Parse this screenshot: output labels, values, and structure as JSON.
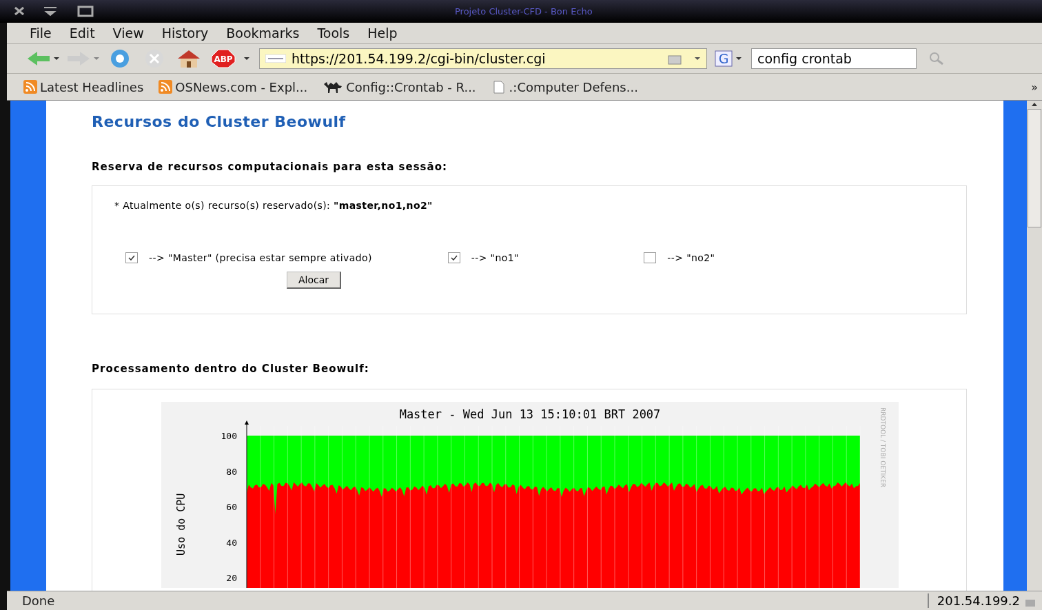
{
  "window": {
    "title": "Projeto Cluster-CFD - Bon Echo"
  },
  "menu": [
    "File",
    "Edit",
    "View",
    "History",
    "Bookmarks",
    "Tools",
    "Help"
  ],
  "toolbar": {
    "abp_label": "ABP",
    "url": "https://201.54.199.2/cgi-bin/cluster.cgi",
    "search_engine": "G",
    "search": "config crontab"
  },
  "bookmarks": {
    "items": [
      {
        "kind": "feed",
        "label": "Latest Headlines"
      },
      {
        "kind": "feed",
        "label": "OSNews.com - Expl..."
      },
      {
        "kind": "camel",
        "label": "Config::Crontab - R..."
      },
      {
        "kind": "page",
        "label": ".:Computer Defens..."
      }
    ],
    "more": "»"
  },
  "page": {
    "title": "Recursos do Cluster Beowulf",
    "reserve": {
      "heading": "Reserva de recursos computacionais para esta sessão:",
      "current": "* Atualmente o(s) recurso(s) reservado(s): **\"master,no1,no2\"**",
      "options": [
        {
          "label": "--> \"Master\" (precisa estar sempre ativado)",
          "checked": true
        },
        {
          "label": "--> \"no1\"",
          "checked": true
        },
        {
          "label": "--> \"no2\"",
          "checked": false
        }
      ],
      "button": "Alocar"
    },
    "processing": {
      "heading": "Processamento dentro do Cluster Beowulf:",
      "side_note": "RRDTOOL / TOBI OETIKER",
      "graph": {
        "title": "Master - Wed Jun 13 15:10:01 BRT 2007",
        "ylabel": "Uso do CPU",
        "yticks": [
          "100",
          "80",
          "60",
          "40",
          "20"
        ]
      }
    }
  },
  "status_bar": {
    "text": "Done",
    "host": "201.54.199.2"
  }
}
